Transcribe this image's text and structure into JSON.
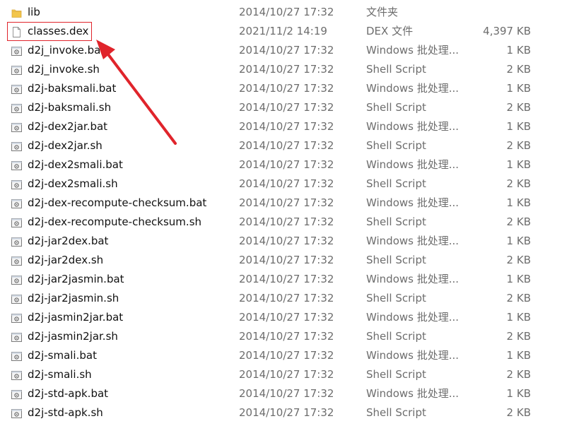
{
  "files": [
    {
      "name": "lib",
      "date": "2014/10/27 17:32",
      "type": "文件夹",
      "size": "",
      "icon": "folder-icon"
    },
    {
      "name": "classes.dex",
      "date": "2021/11/2 14:19",
      "type": "DEX 文件",
      "size": "4,397 KB",
      "icon": "blank-file-icon"
    },
    {
      "name": "d2j_invoke.bat",
      "date": "2014/10/27 17:32",
      "type": "Windows 批处理...",
      "size": "1 KB",
      "icon": "batch-script-icon"
    },
    {
      "name": "d2j_invoke.sh",
      "date": "2014/10/27 17:32",
      "type": "Shell Script",
      "size": "2 KB",
      "icon": "shell-script-icon"
    },
    {
      "name": "d2j-baksmali.bat",
      "date": "2014/10/27 17:32",
      "type": "Windows 批处理...",
      "size": "1 KB",
      "icon": "batch-script-icon"
    },
    {
      "name": "d2j-baksmali.sh",
      "date": "2014/10/27 17:32",
      "type": "Shell Script",
      "size": "2 KB",
      "icon": "shell-script-icon"
    },
    {
      "name": "d2j-dex2jar.bat",
      "date": "2014/10/27 17:32",
      "type": "Windows 批处理...",
      "size": "1 KB",
      "icon": "batch-script-icon"
    },
    {
      "name": "d2j-dex2jar.sh",
      "date": "2014/10/27 17:32",
      "type": "Shell Script",
      "size": "2 KB",
      "icon": "shell-script-icon"
    },
    {
      "name": "d2j-dex2smali.bat",
      "date": "2014/10/27 17:32",
      "type": "Windows 批处理...",
      "size": "1 KB",
      "icon": "batch-script-icon"
    },
    {
      "name": "d2j-dex2smali.sh",
      "date": "2014/10/27 17:32",
      "type": "Shell Script",
      "size": "2 KB",
      "icon": "shell-script-icon"
    },
    {
      "name": "d2j-dex-recompute-checksum.bat",
      "date": "2014/10/27 17:32",
      "type": "Windows 批处理...",
      "size": "1 KB",
      "icon": "batch-script-icon"
    },
    {
      "name": "d2j-dex-recompute-checksum.sh",
      "date": "2014/10/27 17:32",
      "type": "Shell Script",
      "size": "2 KB",
      "icon": "shell-script-icon"
    },
    {
      "name": "d2j-jar2dex.bat",
      "date": "2014/10/27 17:32",
      "type": "Windows 批处理...",
      "size": "1 KB",
      "icon": "batch-script-icon"
    },
    {
      "name": "d2j-jar2dex.sh",
      "date": "2014/10/27 17:32",
      "type": "Shell Script",
      "size": "2 KB",
      "icon": "shell-script-icon"
    },
    {
      "name": "d2j-jar2jasmin.bat",
      "date": "2014/10/27 17:32",
      "type": "Windows 批处理...",
      "size": "1 KB",
      "icon": "batch-script-icon"
    },
    {
      "name": "d2j-jar2jasmin.sh",
      "date": "2014/10/27 17:32",
      "type": "Shell Script",
      "size": "2 KB",
      "icon": "shell-script-icon"
    },
    {
      "name": "d2j-jasmin2jar.bat",
      "date": "2014/10/27 17:32",
      "type": "Windows 批处理...",
      "size": "1 KB",
      "icon": "batch-script-icon"
    },
    {
      "name": "d2j-jasmin2jar.sh",
      "date": "2014/10/27 17:32",
      "type": "Shell Script",
      "size": "2 KB",
      "icon": "shell-script-icon"
    },
    {
      "name": "d2j-smali.bat",
      "date": "2014/10/27 17:32",
      "type": "Windows 批处理...",
      "size": "1 KB",
      "icon": "batch-script-icon"
    },
    {
      "name": "d2j-smali.sh",
      "date": "2014/10/27 17:32",
      "type": "Shell Script",
      "size": "2 KB",
      "icon": "shell-script-icon"
    },
    {
      "name": "d2j-std-apk.bat",
      "date": "2014/10/27 17:32",
      "type": "Windows 批处理...",
      "size": "1 KB",
      "icon": "batch-script-icon"
    },
    {
      "name": "d2j-std-apk.sh",
      "date": "2014/10/27 17:32",
      "type": "Shell Script",
      "size": "2 KB",
      "icon": "shell-script-icon"
    }
  ],
  "colors": {
    "annotation": "#e0242b",
    "folder": "#f3c64b",
    "text_primary": "#111111",
    "text_secondary": "#6d6d6d"
  }
}
